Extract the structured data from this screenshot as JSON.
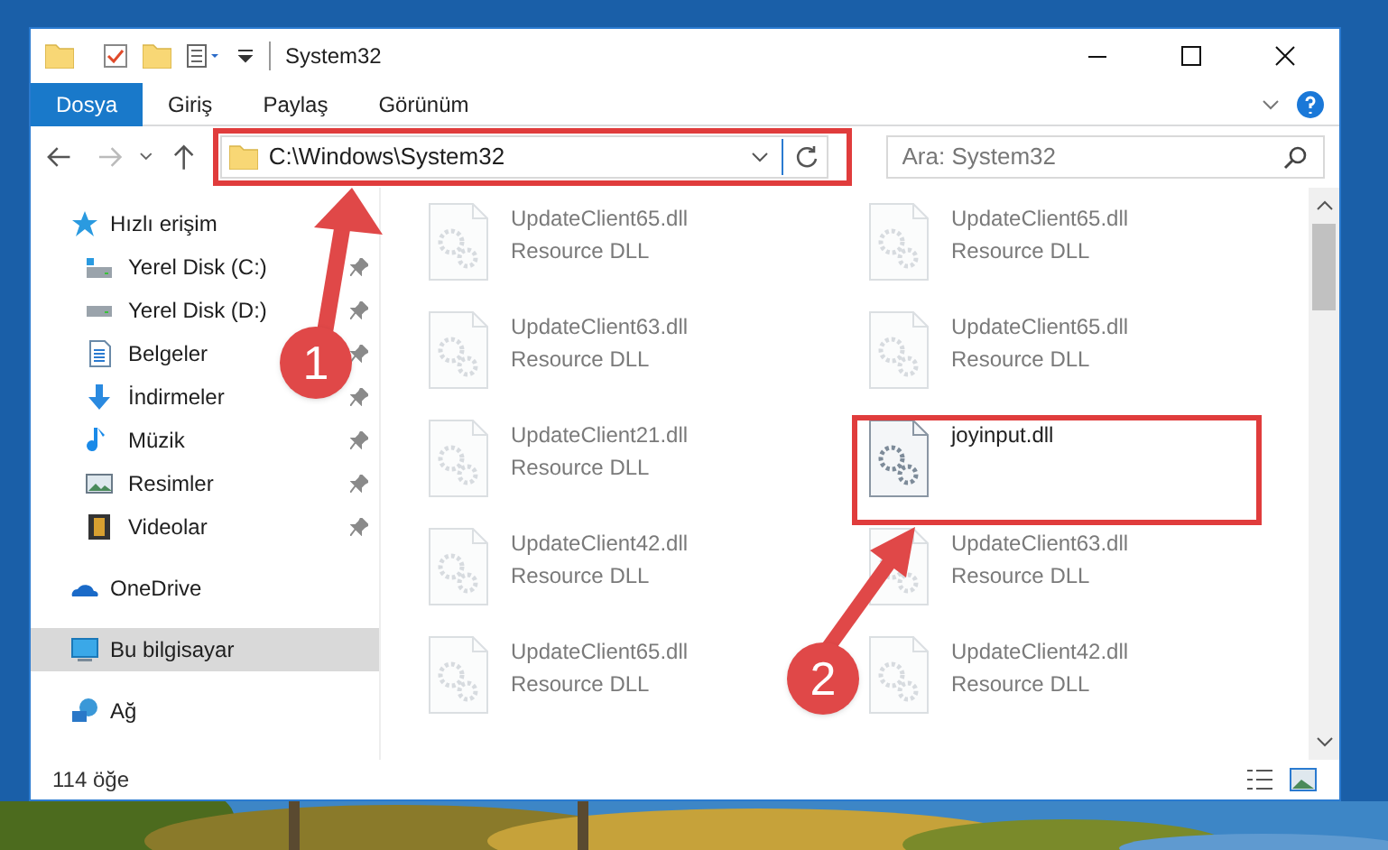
{
  "window": {
    "title": "System32"
  },
  "ribbon_tabs": [
    {
      "label": "Dosya",
      "selected": true
    },
    {
      "label": "Giriş",
      "selected": false
    },
    {
      "label": "Paylaş",
      "selected": false
    },
    {
      "label": "Görünüm",
      "selected": false
    }
  ],
  "address_bar": {
    "path": "C:\\Windows\\System32"
  },
  "search": {
    "placeholder": "Ara: System32"
  },
  "nav_pane": [
    {
      "label": "Hızlı erişim",
      "selected": false,
      "children": [
        {
          "label": "Yerel Disk (C:)",
          "pinned": true
        },
        {
          "label": "Yerel Disk (D:)",
          "pinned": true
        },
        {
          "label": "Belgeler",
          "pinned": true
        },
        {
          "label": "İndirmeler",
          "pinned": true
        },
        {
          "label": "Müzik",
          "pinned": true
        },
        {
          "label": "Resimler",
          "pinned": true
        },
        {
          "label": "Videolar",
          "pinned": true
        }
      ]
    },
    {
      "label": "OneDrive",
      "selected": false
    },
    {
      "label": "Bu bilgisayar",
      "selected": true
    },
    {
      "label": "Ağ",
      "selected": false
    }
  ],
  "files": [
    {
      "name": "UpdateClient65.dll",
      "type": "Resource DLL",
      "blurred": true
    },
    {
      "name": "UpdateClient65.dll",
      "type": "Resource DLL",
      "blurred": true
    },
    {
      "name": "UpdateClient63.dll",
      "type": "Resource DLL",
      "blurred": true
    },
    {
      "name": "UpdateClient65.dll",
      "type": "Resource DLL",
      "blurred": true
    },
    {
      "name": "UpdateClient21.dll",
      "type": "Resource DLL",
      "blurred": true
    },
    {
      "name": "joyinput.dll",
      "blurred": false
    },
    {
      "name": "UpdateClient42.dll",
      "type": "Resource DLL",
      "blurred": true
    },
    {
      "name": "UpdateClient63.dll",
      "type": "Resource DLL",
      "blurred": true
    },
    {
      "name": "UpdateClient65.dll",
      "type": "Resource DLL",
      "blurred": true
    },
    {
      "name": "UpdateClient42.dll",
      "type": "Resource DLL",
      "blurred": true
    }
  ],
  "status_bar": {
    "item_count": "114 öğe"
  },
  "annotations": [
    {
      "label": "1"
    },
    {
      "label": "2"
    }
  ]
}
